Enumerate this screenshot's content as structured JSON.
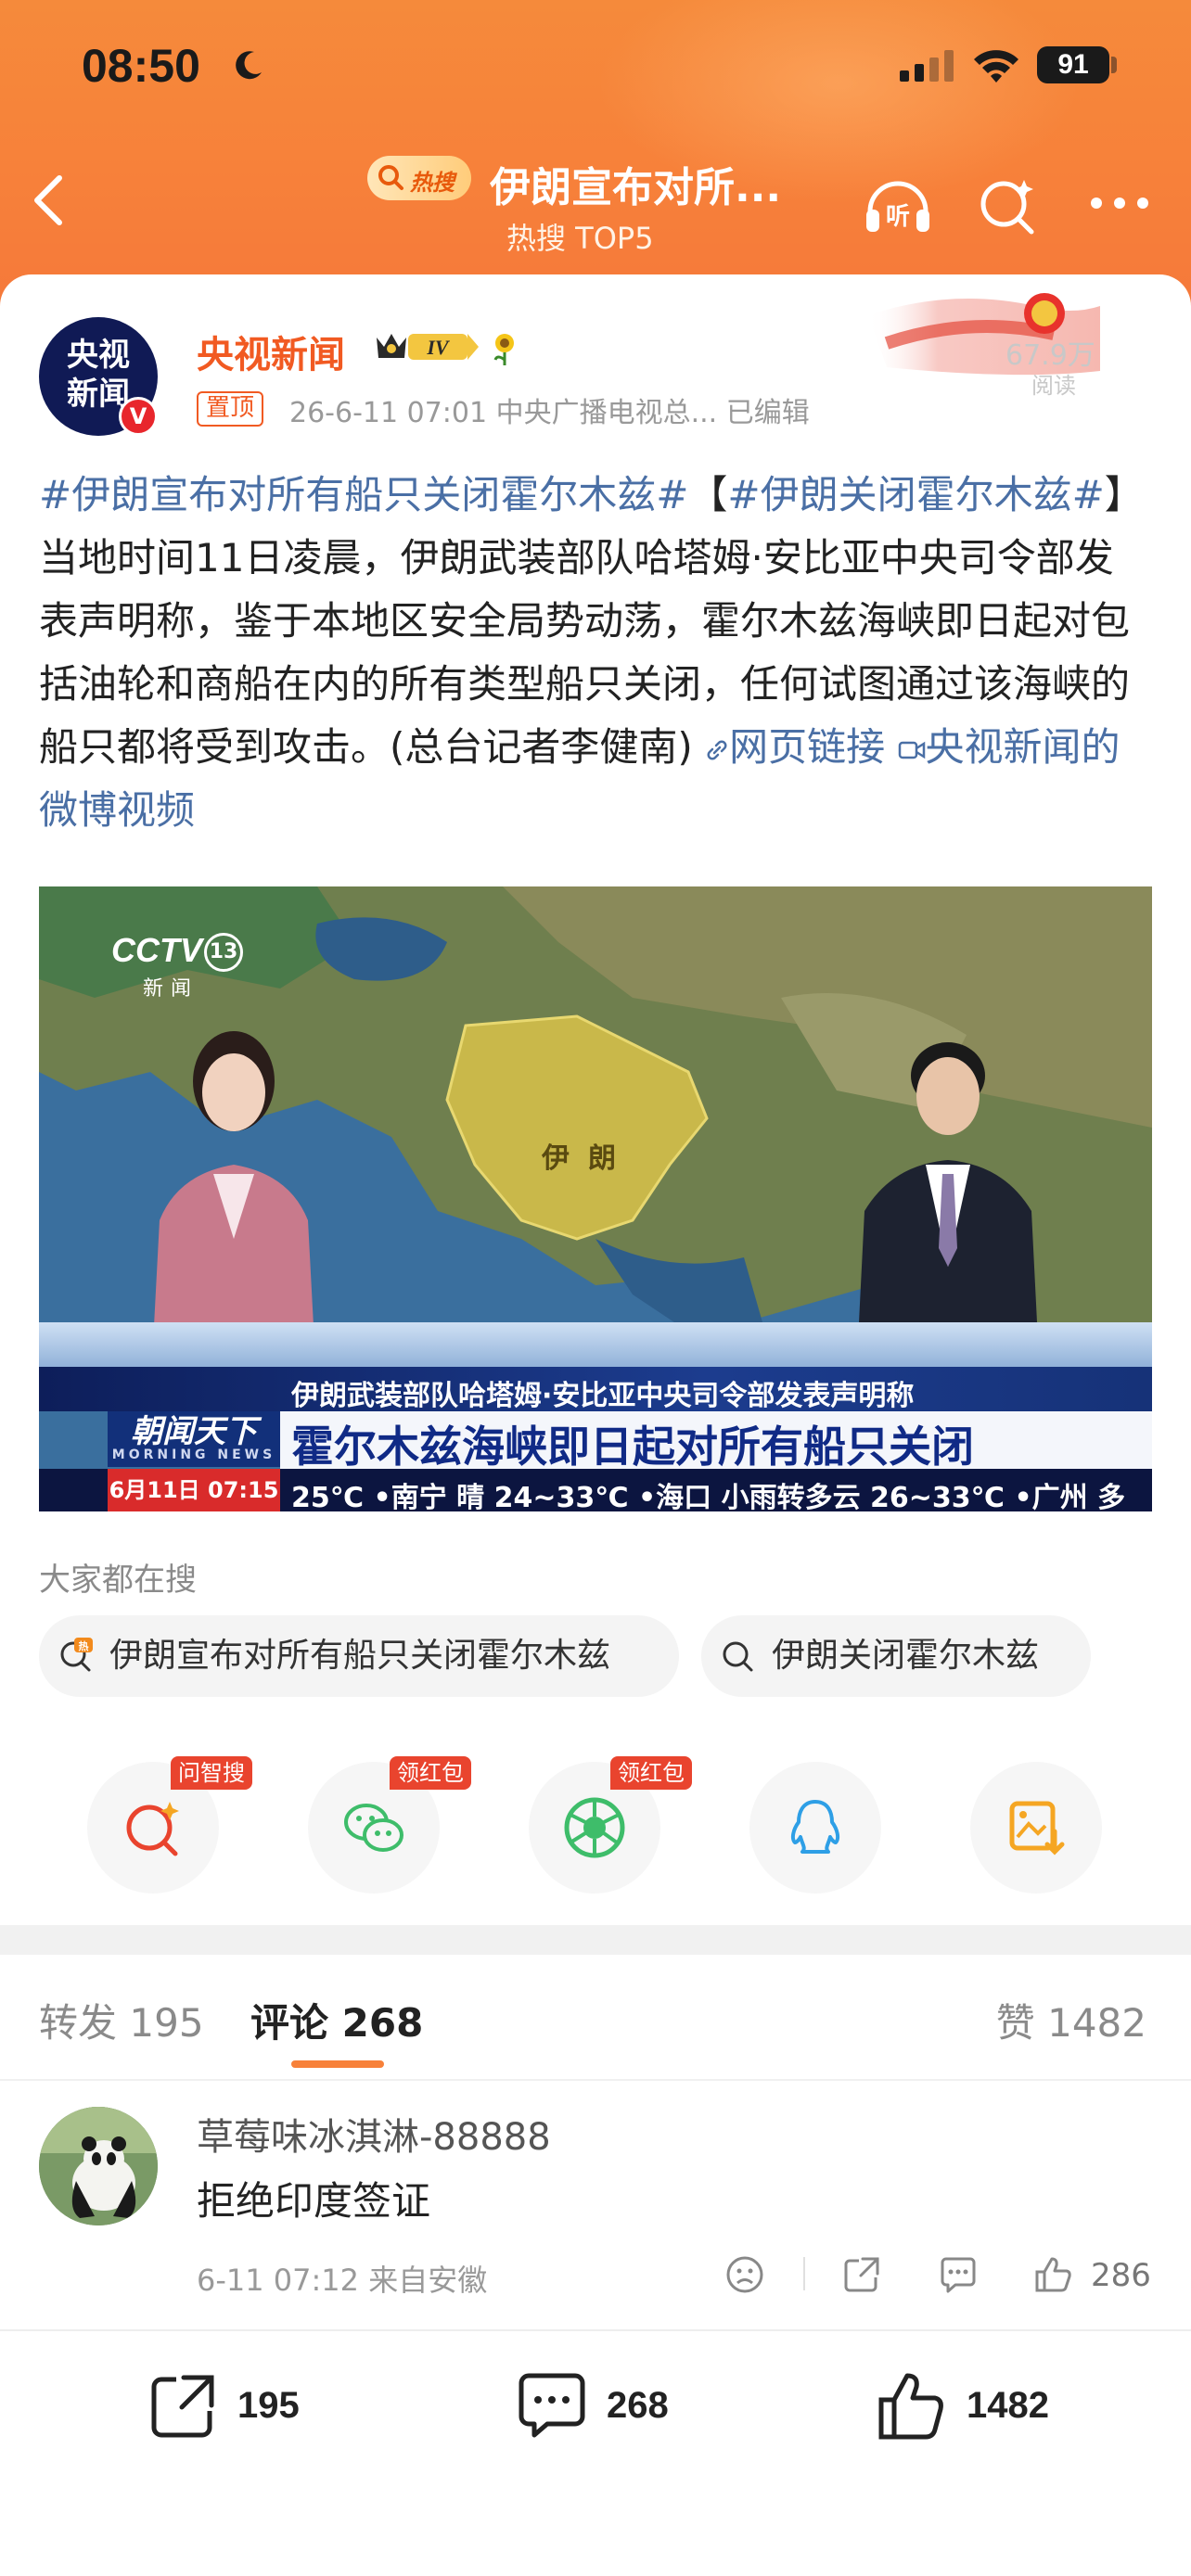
{
  "status_bar": {
    "time": "08:50",
    "battery": "91"
  },
  "nav": {
    "hot_badge": "热搜",
    "title": "伊朗宣布对所...",
    "subtitle": "热搜 TOP5"
  },
  "post": {
    "author": "央视新闻",
    "avatar_text": "央视新闻",
    "level": "IV",
    "pinned_label": "置顶",
    "meta": "26-6-11 07:01  中央广播电视总...  已编辑",
    "read_count": "67.9万",
    "read_label": "阅读",
    "tag1": "#伊朗宣布对所有船只关闭霍尔木兹#",
    "bracket_open": "【",
    "tag2": "#伊朗关闭霍尔木兹#",
    "body": "】当地时间11日凌晨，伊朗武装部队哈塔姆·安比亚中央司令部发表声明称，鉴于本地区安全局势动荡，霍尔木兹海峡即日起对包括油轮和商船在内的所有类型船只关闭，任何试图通过该海峡的船只都将受到攻击。(总台记者李健南)",
    "link_web": "网页链接",
    "link_video": "央视新闻的微博视频"
  },
  "video": {
    "channel": "CCTV",
    "channel_num": "13",
    "channel_sub": "新闻",
    "map_label": "伊朗",
    "ticker_top": "伊朗武装部队哈塔姆·安比亚中央司令部发表声明称",
    "ticker_main": "霍尔木兹海峡即日起对所有船只关闭",
    "show_name": "朝闻天下",
    "show_sub": "MORNING NEWS",
    "date": "6月11日 07:15",
    "weather": "25℃  •南宁 晴 24~33℃  •海口 小雨转多云 26~33℃  •广州 多"
  },
  "related_search": {
    "title": "大家都在搜",
    "chips": [
      "伊朗宣布对所有船只关闭霍尔木兹",
      "伊朗关闭霍尔木兹"
    ]
  },
  "share": {
    "tags": [
      "问智搜",
      "领红包",
      "领红包"
    ]
  },
  "tabs": {
    "repost_label": "转发",
    "repost_count": "195",
    "comment_label": "评论",
    "comment_count": "268",
    "like_label": "赞",
    "like_count": "1482"
  },
  "comment": {
    "user": "草莓味冰淇淋-88888",
    "text": "拒绝印度签证",
    "meta": "6-11 07:12  来自安徽",
    "likes": "286"
  },
  "action_bar": {
    "repost": "195",
    "comment": "268",
    "like": "1482"
  },
  "colors": {
    "accent": "#f7813a",
    "link": "#4a6fa5",
    "author": "#f15a22"
  }
}
